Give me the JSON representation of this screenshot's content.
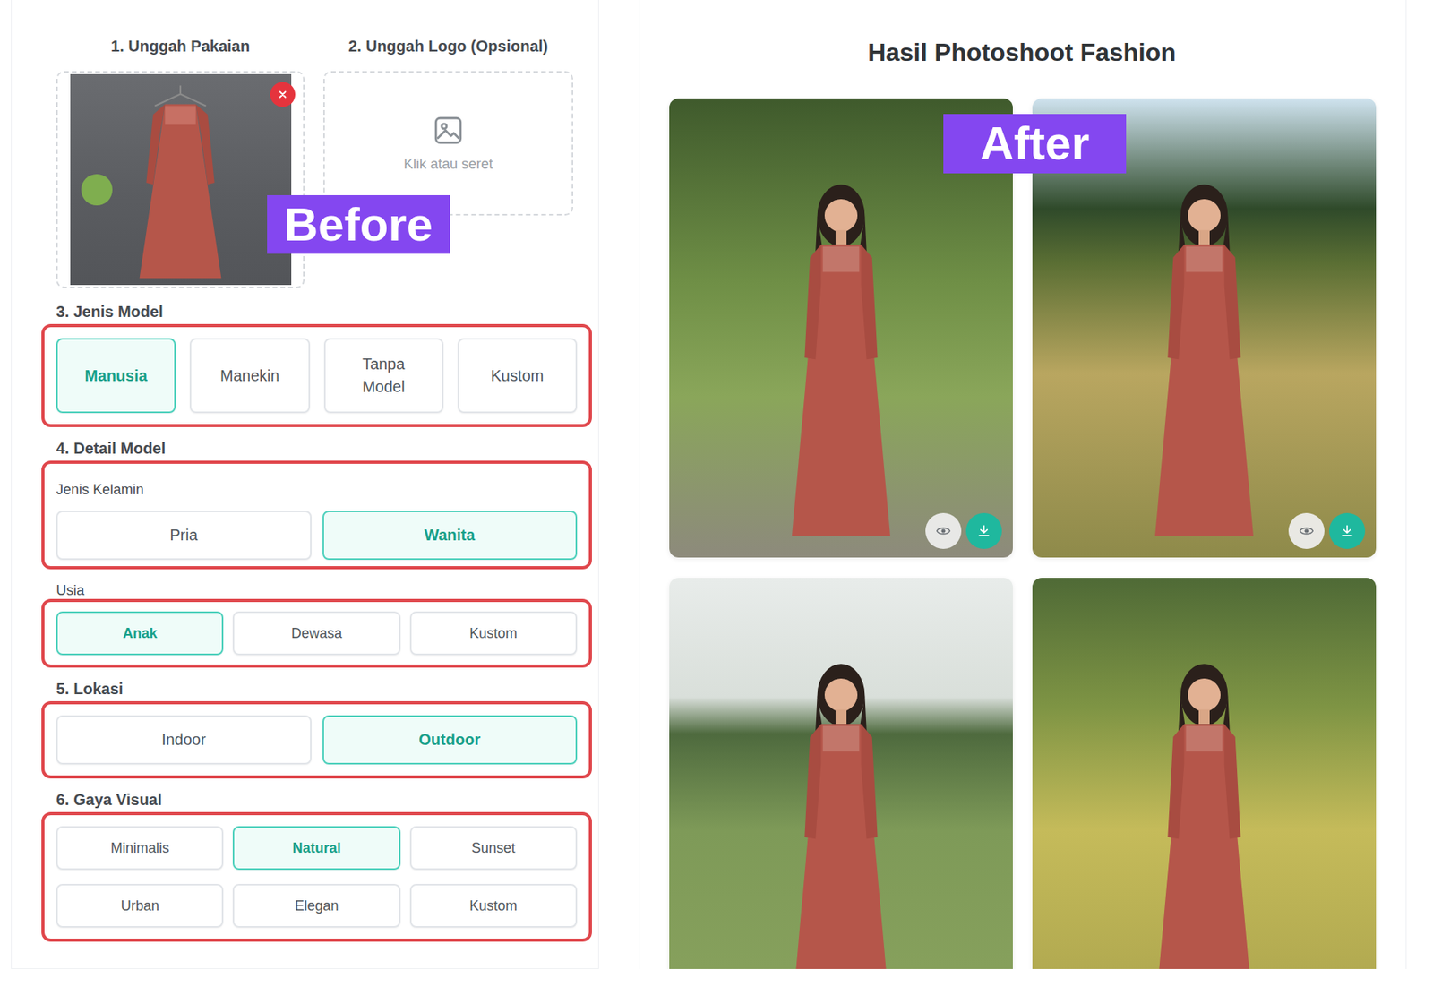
{
  "upload": {
    "clothing_label": "1. Unggah Pakaian",
    "logo_label": "2. Unggah Logo (Opsional)",
    "logo_hint": "Klik atau seret"
  },
  "badges": {
    "before": "Before",
    "after": "After"
  },
  "model_type": {
    "title": "3. Jenis Model",
    "options": [
      {
        "label": "Manusia",
        "selected": true
      },
      {
        "label": "Manekin",
        "selected": false
      },
      {
        "label": "Tanpa Model",
        "selected": false
      },
      {
        "label": "Kustom",
        "selected": false
      }
    ]
  },
  "model_detail": {
    "title": "4. Detail Model",
    "gender": {
      "label": "Jenis Kelamin",
      "options": [
        {
          "label": "Pria",
          "selected": false
        },
        {
          "label": "Wanita",
          "selected": true
        }
      ]
    },
    "age": {
      "label": "Usia",
      "options": [
        {
          "label": "Anak",
          "selected": true
        },
        {
          "label": "Dewasa",
          "selected": false
        },
        {
          "label": "Kustom",
          "selected": false
        }
      ]
    }
  },
  "location": {
    "title": "5. Lokasi",
    "options": [
      {
        "label": "Indoor",
        "selected": false
      },
      {
        "label": "Outdoor",
        "selected": true
      }
    ]
  },
  "visual_style": {
    "title": "6. Gaya Visual",
    "options": [
      {
        "label": "Minimalis",
        "selected": false
      },
      {
        "label": "Natural",
        "selected": true
      },
      {
        "label": "Sunset",
        "selected": false
      },
      {
        "label": "Urban",
        "selected": false
      },
      {
        "label": "Elegan",
        "selected": false
      },
      {
        "label": "Kustom",
        "selected": false
      }
    ]
  },
  "results": {
    "title": "Hasil Photoshoot Fashion",
    "photos": [
      {
        "show_actions": true
      },
      {
        "show_actions": true
      },
      {
        "show_actions": false
      },
      {
        "show_actions": false
      }
    ]
  }
}
